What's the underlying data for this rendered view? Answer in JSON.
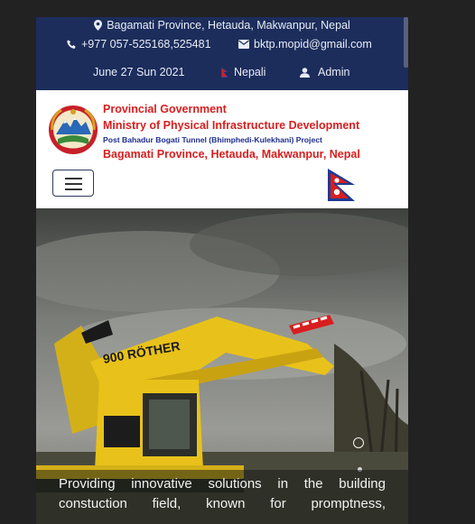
{
  "topbar": {
    "address": "Bagamati Province, Hetauda, Makwanpur, Nepal",
    "phone": "+977 057-525168,525481",
    "email": "bktp.mopid@gmail.com",
    "date": "June 27 Sun 2021",
    "language": "Nepali",
    "admin": "Admin"
  },
  "header": {
    "line1": "Provincial Government",
    "line2": "Ministry of Physical Infrastructure Development",
    "line3": "Post Bahadur Bogati Tunnel (Bhimphedi-Kulekhani) Project",
    "line4": "Bagamati Province, Hetauda, Makwanpur, Nepal"
  },
  "hero": {
    "caption": "Providing innovative solutions in the building constuction field, known for promptness,",
    "excavator_brand": "900 RÖTHER",
    "slides": {
      "count": 2,
      "active": 1
    }
  },
  "colors": {
    "page_bg": "#222222",
    "topbar_bg": "#1c2d5c",
    "header_red": "#d81e1e",
    "header_blue": "#1d2c8f",
    "excavator_yellow": "#e8c21a"
  },
  "icons": [
    "map-marker-icon",
    "phone-icon",
    "envelope-icon",
    "nepal-flag-icon",
    "user-icon",
    "menu-icon"
  ]
}
